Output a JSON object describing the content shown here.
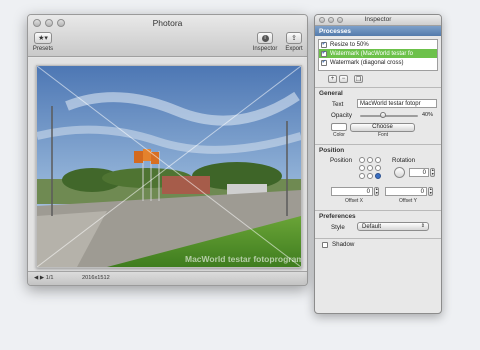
{
  "main_window": {
    "title": "Photora",
    "toolbar": {
      "presets_label": "Presets",
      "inspector_label": "Inspector",
      "export_label": "Export"
    },
    "watermark_text": "MacWorld testar fotoprogram",
    "status": {
      "nav": "◀ ▶ 1/1",
      "dimensions": "2016x1512"
    }
  },
  "inspector": {
    "title": "Inspector",
    "processes": {
      "heading": "Processes",
      "items": [
        {
          "label": "Resize to 50%",
          "checked": true,
          "selected": false
        },
        {
          "label": "Watermark (MacWorld testar fo",
          "checked": true,
          "selected": true
        },
        {
          "label": "Watermark (diagonal cross)",
          "checked": true,
          "selected": false
        }
      ],
      "add": "+",
      "remove": "−"
    },
    "general": {
      "heading": "General",
      "text_label": "Text",
      "text_value": "MacWorld testar fotopr",
      "opacity_label": "Opacity",
      "opacity_value": "40%",
      "opacity_fraction": 0.4,
      "color_label": "Color",
      "font_button": "Choose",
      "font_label": "Font"
    },
    "position": {
      "heading": "Position",
      "position_label": "Position",
      "rotation_label": "Rotation",
      "rotation_value": "0",
      "selected_anchor": 8,
      "offset_x_value": "0",
      "offset_x_label": "Offset X",
      "offset_y_value": "0",
      "offset_y_label": "Offset Y"
    },
    "preferences": {
      "heading": "Preferences",
      "style_label": "Style",
      "style_value": "Default",
      "shadow_label": "Shadow",
      "shadow_checked": false
    }
  }
}
